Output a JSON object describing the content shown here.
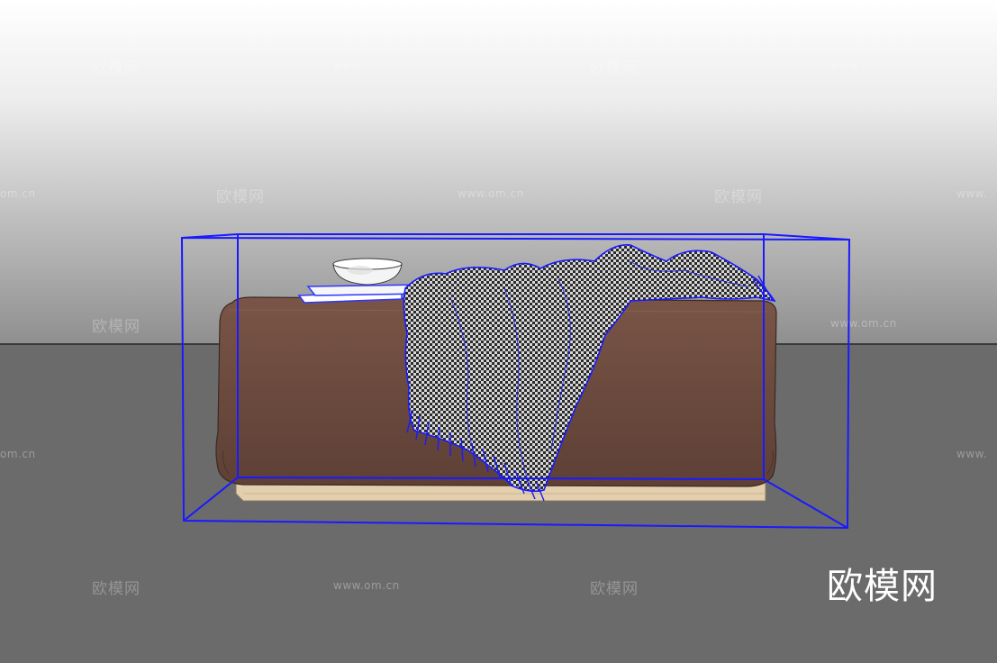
{
  "logo": {
    "text": "欧模网"
  },
  "watermarks": {
    "brand": "欧模网",
    "url": "www.om.cn",
    "url_partial_left": "om.cn",
    "url_partial_right": "www."
  },
  "colors": {
    "bounding_box": "#1a1aff",
    "ottoman_leather": "#6b4a3e",
    "ottoman_base": "#e3cfae",
    "throw_blanket": "#8a8a8a",
    "book": "#2f36ff",
    "bowl": "#f4f4f4"
  },
  "icons": {
    "scene": "3d-model-ottoman-with-throw-blanket"
  }
}
